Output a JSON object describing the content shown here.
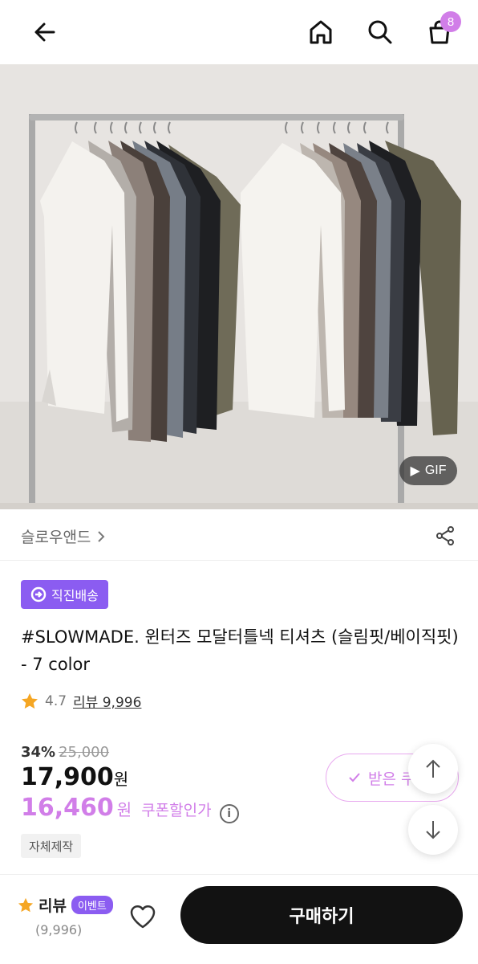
{
  "header": {
    "cart_count": "8",
    "icons": [
      "arrow-left-icon",
      "home-icon",
      "search-icon",
      "shopping-bag-icon"
    ]
  },
  "hero": {
    "gif_label": "GIF"
  },
  "brand": {
    "name": "슬로우앤드"
  },
  "badge": {
    "label": "직진배송"
  },
  "product": {
    "title": "#SLOWMADE. 윈터즈 모달터틀넥 티셔츠 (슬림핏/베이직핏) - 7 color",
    "rating": "4.7",
    "reviews_label": "리뷰 9,996",
    "discount_pct": "34%",
    "original_price": "25,000",
    "price": "17,900",
    "price_unit": "원",
    "coupon_price": "16,460",
    "coupon_unit": "원",
    "coupon_label": "쿠폰할인가",
    "tag": "자체제작"
  },
  "coupon_button": {
    "label": "받은 쿠"
  },
  "bottom_bar": {
    "review_label": "리뷰",
    "event_label": "이벤트",
    "review_count": "(9,996)",
    "buy_label": "구매하기"
  },
  "colors": {
    "accent_purple": "#8b5cf1",
    "accent_pink": "#d17ee8",
    "star": "#f5a623",
    "buy_button": "#121212"
  }
}
